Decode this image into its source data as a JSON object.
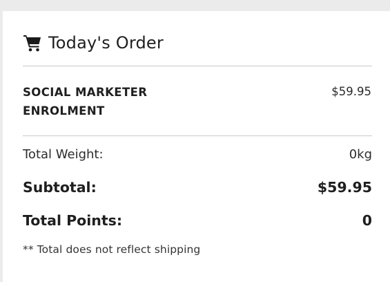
{
  "order": {
    "title": "Today's Order",
    "icon": "shopping-cart-icon",
    "items": [
      {
        "name": "SOCIAL MARKETER ENROLMENT",
        "price": "$59.95"
      }
    ],
    "total_weight_label": "Total Weight:",
    "total_weight_value": "0kg",
    "subtotal_label": "Subtotal:",
    "subtotal_value": "$59.95",
    "total_points_label": "Total Points:",
    "total_points_value": "0",
    "note": "** Total does not reflect shipping"
  },
  "colors": {
    "background": "#ebebeb",
    "card": "#ffffff",
    "text": "#1f1f1f",
    "divider": "#c8c8c8"
  }
}
